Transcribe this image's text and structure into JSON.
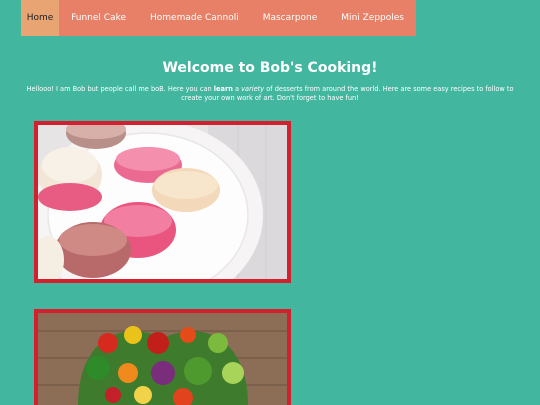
{
  "nav": {
    "items": [
      {
        "label": "Home"
      },
      {
        "label": "Funnel Cake"
      },
      {
        "label": "Homemade Cannoli"
      },
      {
        "label": "Mascarpone"
      },
      {
        "label": "Mini Zeppoles"
      }
    ]
  },
  "page": {
    "title": "Welcome to Bob's Cooking!",
    "intro_1": "Hellooo! I am Bob but people call me boB. Here you can ",
    "intro_bold": "learn",
    "intro_2": " a ",
    "intro_italic": "variety",
    "intro_3": " of desserts from around the world. Here are some easy recipes to follow to create your own work of art. Don't forget to have fun!"
  },
  "images": [
    {
      "subject": "macarons-photo"
    },
    {
      "subject": "vegetables-heart-photo"
    }
  ],
  "colors": {
    "background": "#43b6a0",
    "nav": "#e87f67",
    "nav_active": "#e8a472",
    "image_border": "#d4202e"
  }
}
